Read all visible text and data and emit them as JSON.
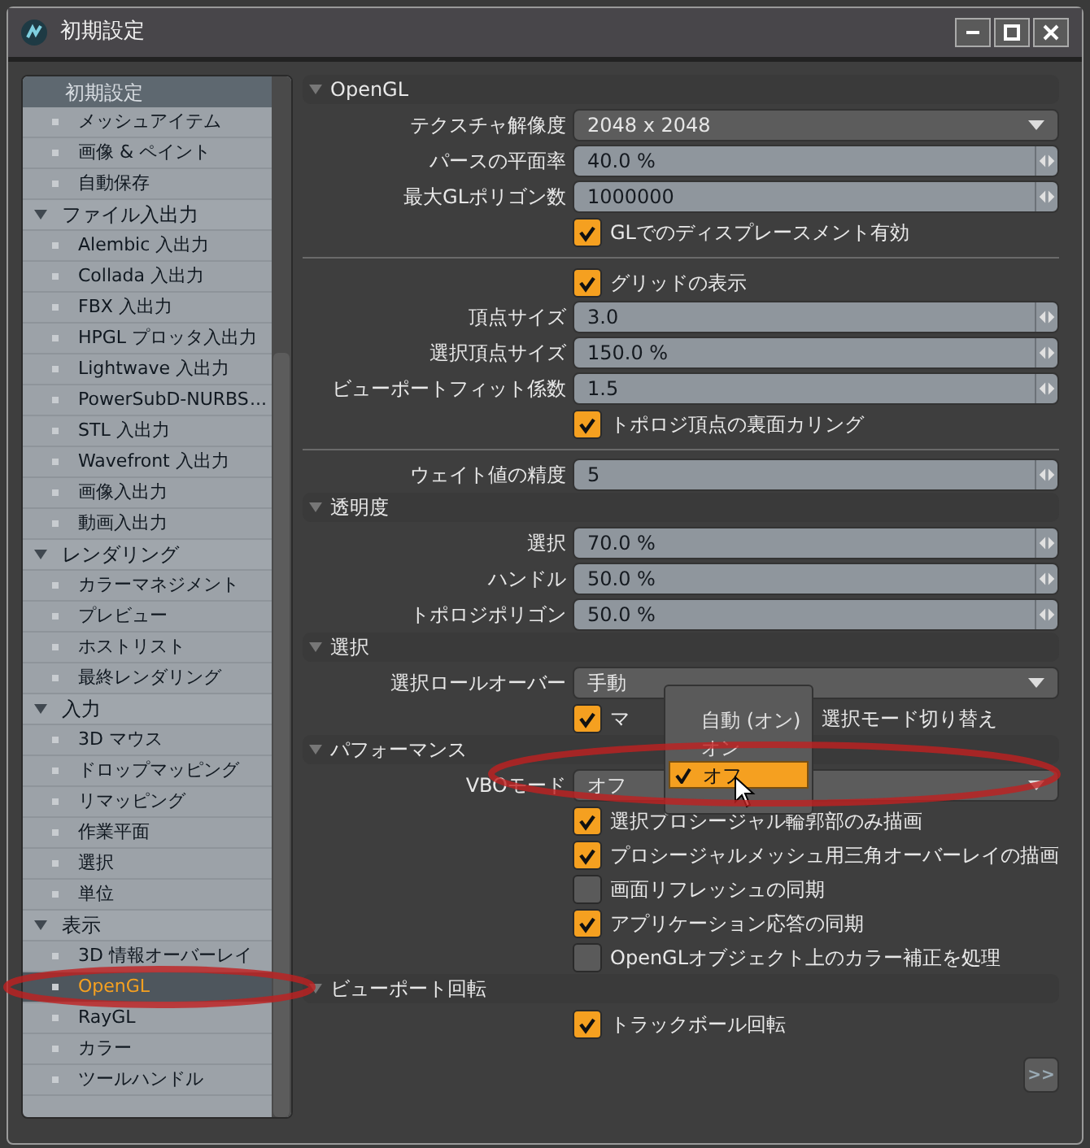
{
  "window": {
    "title": "初期設定"
  },
  "sidebar": {
    "header": "初期設定",
    "leading_items": [
      {
        "label": "メッシュアイテム",
        "selected": false
      },
      {
        "label": "画像 & ペイント",
        "selected": false
      },
      {
        "label": "自動保存",
        "selected": false
      }
    ],
    "groups": [
      {
        "label": "ファイル入出力",
        "expanded": true,
        "children": [
          {
            "label": "Alembic 入出力",
            "selected": false
          },
          {
            "label": "Collada 入出力",
            "selected": false
          },
          {
            "label": "FBX 入出力",
            "selected": false
          },
          {
            "label": "HPGL プロッタ入出力",
            "selected": false
          },
          {
            "label": "Lightwave 入出力",
            "selected": false
          },
          {
            "label": "PowerSubD-NURBS",
            "more": "...",
            "selected": false
          },
          {
            "label": "STL 入出力",
            "selected": false
          },
          {
            "label": "Wavefront 入出力",
            "selected": false
          },
          {
            "label": "画像入出力",
            "selected": false
          },
          {
            "label": "動画入出力",
            "selected": false
          }
        ]
      },
      {
        "label": "レンダリング",
        "expanded": true,
        "children": [
          {
            "label": "カラーマネジメント",
            "selected": false
          },
          {
            "label": "プレビュー",
            "selected": false
          },
          {
            "label": "ホストリスト",
            "selected": false
          },
          {
            "label": "最終レンダリング",
            "selected": false
          }
        ]
      },
      {
        "label": "入力",
        "expanded": true,
        "children": [
          {
            "label": "3D マウス",
            "selected": false
          },
          {
            "label": "ドロップマッピング",
            "selected": false
          },
          {
            "label": "リマッピング",
            "selected": false
          },
          {
            "label": "作業平面",
            "selected": false
          },
          {
            "label": "選択",
            "selected": false
          },
          {
            "label": "単位",
            "selected": false
          }
        ]
      },
      {
        "label": "表示",
        "expanded": true,
        "children": [
          {
            "label": "3D 情報オーバーレイ",
            "selected": false
          },
          {
            "label": "OpenGL",
            "selected": true
          },
          {
            "label": "RayGL",
            "selected": false
          },
          {
            "label": "カラー",
            "selected": false
          },
          {
            "label": "ツールハンドル",
            "selected": false
          }
        ]
      }
    ]
  },
  "sections": [
    {
      "title": "OpenGL",
      "expanded": true,
      "items": [
        {
          "kind": "dropdown",
          "label": "テクスチャ解像度",
          "value": "2048 x 2048"
        },
        {
          "kind": "slider",
          "label": "パースの平面率",
          "value": "40.0 %"
        },
        {
          "kind": "slider",
          "label": "最大GLポリゴン数",
          "value": "1000000"
        },
        {
          "kind": "checkbox",
          "label": "GLでのディスプレースメント有効",
          "checked": true
        },
        {
          "kind": "separator"
        },
        {
          "kind": "checkbox",
          "label": "グリッドの表示",
          "checked": true
        },
        {
          "kind": "slider",
          "label": "頂点サイズ",
          "value": "3.0"
        },
        {
          "kind": "slider",
          "label": "選択頂点サイズ",
          "value": "150.0 %"
        },
        {
          "kind": "slider",
          "label": "ビューポートフィット係数",
          "value": "1.5"
        },
        {
          "kind": "checkbox",
          "label": "トポロジ頂点の裏面カリング",
          "checked": true
        },
        {
          "kind": "separator"
        },
        {
          "kind": "slider",
          "label": "ウェイト値の精度",
          "value": "5"
        }
      ]
    },
    {
      "title": "透明度",
      "expanded": true,
      "items": [
        {
          "kind": "slider",
          "label": "選択",
          "value": "70.0 %"
        },
        {
          "kind": "slider",
          "label": "ハンドル",
          "value": "50.0 %"
        },
        {
          "kind": "slider",
          "label": "トポロジポリゴン",
          "value": "50.0 %"
        }
      ]
    },
    {
      "title": "選択",
      "expanded": true,
      "items": [
        {
          "kind": "dropdown",
          "label": "選択ロールオーバー",
          "value": "手動"
        },
        {
          "kind": "checkbox",
          "label_parts": [
            "マ",
            "選択モード切り替え"
          ],
          "checked": true
        }
      ]
    },
    {
      "title": "パフォーマンス",
      "expanded": true,
      "items": [
        {
          "kind": "dropdown",
          "label": "VBOモード",
          "value": "オフ"
        },
        {
          "kind": "checkbox",
          "label": "選択プロシージャル輪郭部のみ描画",
          "checked": true
        },
        {
          "kind": "checkbox",
          "label": "プロシージャルメッシュ用三角オーバーレイの描画",
          "checked": true
        },
        {
          "kind": "checkbox",
          "label": "画面リフレッシュの同期",
          "checked": false
        },
        {
          "kind": "checkbox",
          "label": "アプリケーション応答の同期",
          "checked": true
        },
        {
          "kind": "checkbox",
          "label": "OpenGLオブジェクト上のカラー補正を処理",
          "checked": false
        }
      ]
    },
    {
      "title": "ビューポート回転",
      "expanded": true,
      "items": [
        {
          "kind": "checkbox",
          "label": "トラックボール回転",
          "checked": true
        }
      ]
    }
  ],
  "next_button": ">>",
  "popup": {
    "options": [
      {
        "label": "自動 (オン)",
        "selected": false
      },
      {
        "label": "オン",
        "selected": false
      },
      {
        "label": "オフ",
        "selected": true
      }
    ]
  }
}
